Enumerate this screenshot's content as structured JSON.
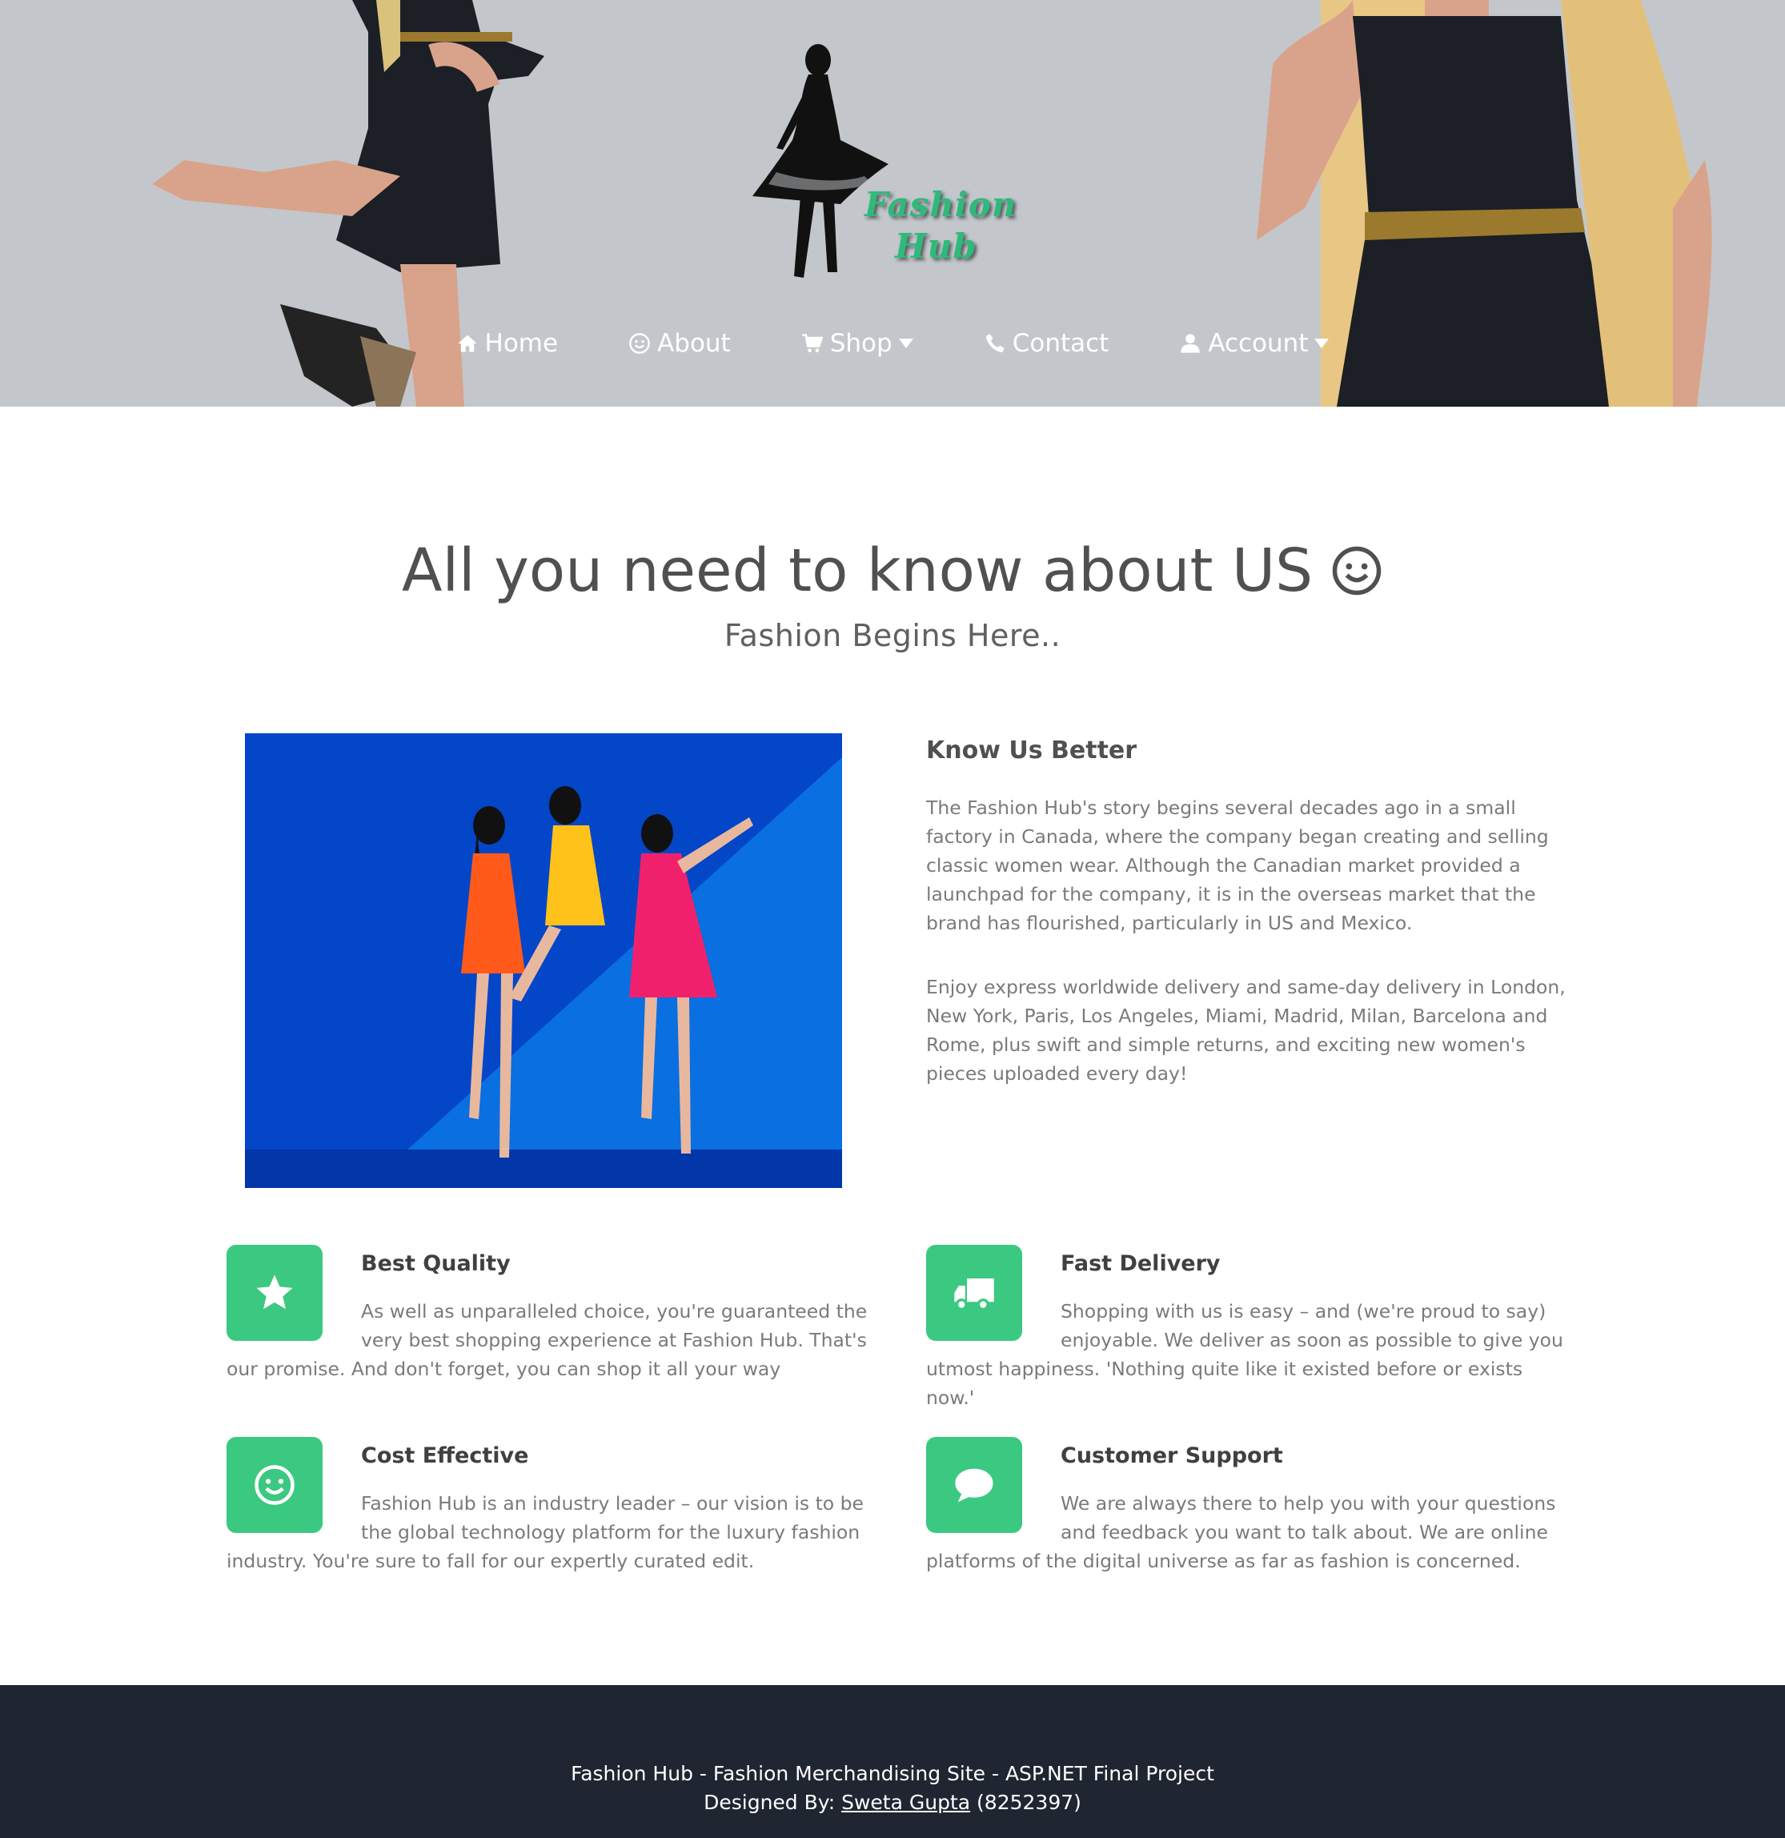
{
  "brand": {
    "logo_line1": "Fashion",
    "logo_line2": "Hub"
  },
  "nav": {
    "home": "Home",
    "about": "About",
    "shop": "Shop",
    "contact": "Contact",
    "account": "Account"
  },
  "hero": {
    "title": "All you need to know about US",
    "subtitle": "Fashion Begins Here.."
  },
  "know": {
    "heading": "Know Us Better",
    "paragraph1": "The Fashion Hub's story begins several decades ago in a small factory in Canada, where the company began creating and selling classic women wear. Although the Canadian market provided a launchpad for the company, it is in the overseas market that the brand has flourished, particularly in US and Mexico.",
    "paragraph2": "Enjoy express worldwide delivery and same-day delivery in London, New York, Paris, Los Angeles, Miami, Madrid, Milan, Barcelona and Rome, plus swift and simple returns, and exciting new women's pieces uploaded every day!"
  },
  "features": [
    {
      "icon": "star-icon",
      "title": "Best Quality",
      "text": "As well as unparalleled choice, you're guaranteed the very best shopping experience at Fashion Hub. That's our promise. And don't forget, you can shop it all your way"
    },
    {
      "icon": "truck-icon",
      "title": "Fast Delivery",
      "text": "Shopping with us is easy – and (we're proud to say) enjoyable. We deliver as soon as possible to give you utmost happiness. 'Nothing quite like it existed before or exists now.'"
    },
    {
      "icon": "smile-icon",
      "title": "Cost Effective",
      "text": "Fashion Hub is an industry leader – our vision is to be the global technology platform for the luxury fashion industry. You're sure to fall for our expertly curated edit."
    },
    {
      "icon": "chat-bubble-icon",
      "title": "Customer Support",
      "text": "We are always there to help you with your questions and feedback you want to talk about. We are online platforms of the digital universe as far as fashion is concerned."
    }
  ],
  "footer": {
    "line1": "Fashion Hub - Fashion Merchandising Site - ASP.NET Final Project",
    "designed_by": "Designed By:",
    "author": "Sweta Gupta",
    "author_id": "(8252397)"
  },
  "colors": {
    "accent": "#3bc981",
    "header_bg": "#c3c7cc",
    "footer_bg": "#1f2531",
    "photo_bg": "#0446c8"
  }
}
